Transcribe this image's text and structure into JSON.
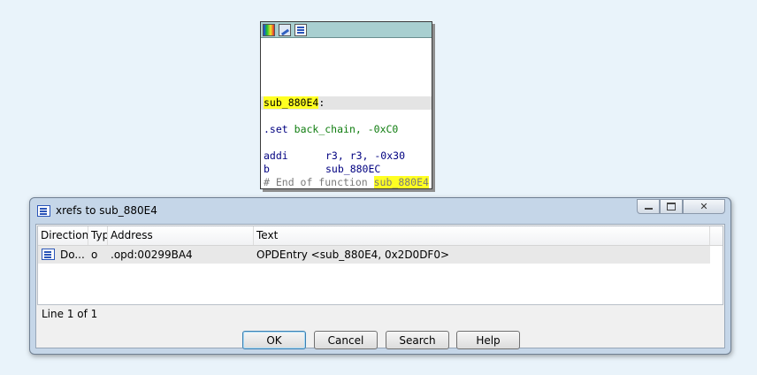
{
  "graph_node": {
    "toolbar_icons": [
      "color-palette-icon",
      "graph-edit-icon",
      "xrefs-icon"
    ],
    "label_name": "sub_880E4",
    "label_suffix": ":",
    "directive": ".set",
    "directive_args": "back_chain, -0xC0",
    "instr1_mnemonic": "addi",
    "instr1_operands": "r3, r3, -0x30",
    "instr2_mnemonic": "b",
    "instr2_operands": "sub_880EC",
    "end_comment_prefix": "# End of function ",
    "end_comment_name": "sub_880E4"
  },
  "xrefs_window": {
    "title": "xrefs to sub_880E4",
    "columns": [
      "Direction",
      "Typ",
      "Address",
      "Text"
    ],
    "rows": [
      {
        "direction": "Do...",
        "type": "o",
        "address": ".opd:00299BA4",
        "text": "OPDEntry <sub_880E4, 0x2D0DF0>"
      }
    ],
    "status": "Line 1 of 1",
    "buttons": {
      "ok": "OK",
      "cancel": "Cancel",
      "search": "Search",
      "help": "Help"
    }
  },
  "colors": {
    "highlight": "#ffff22",
    "node_toolbar": "#a8cfd0",
    "desktop": "#e9f3fa"
  }
}
